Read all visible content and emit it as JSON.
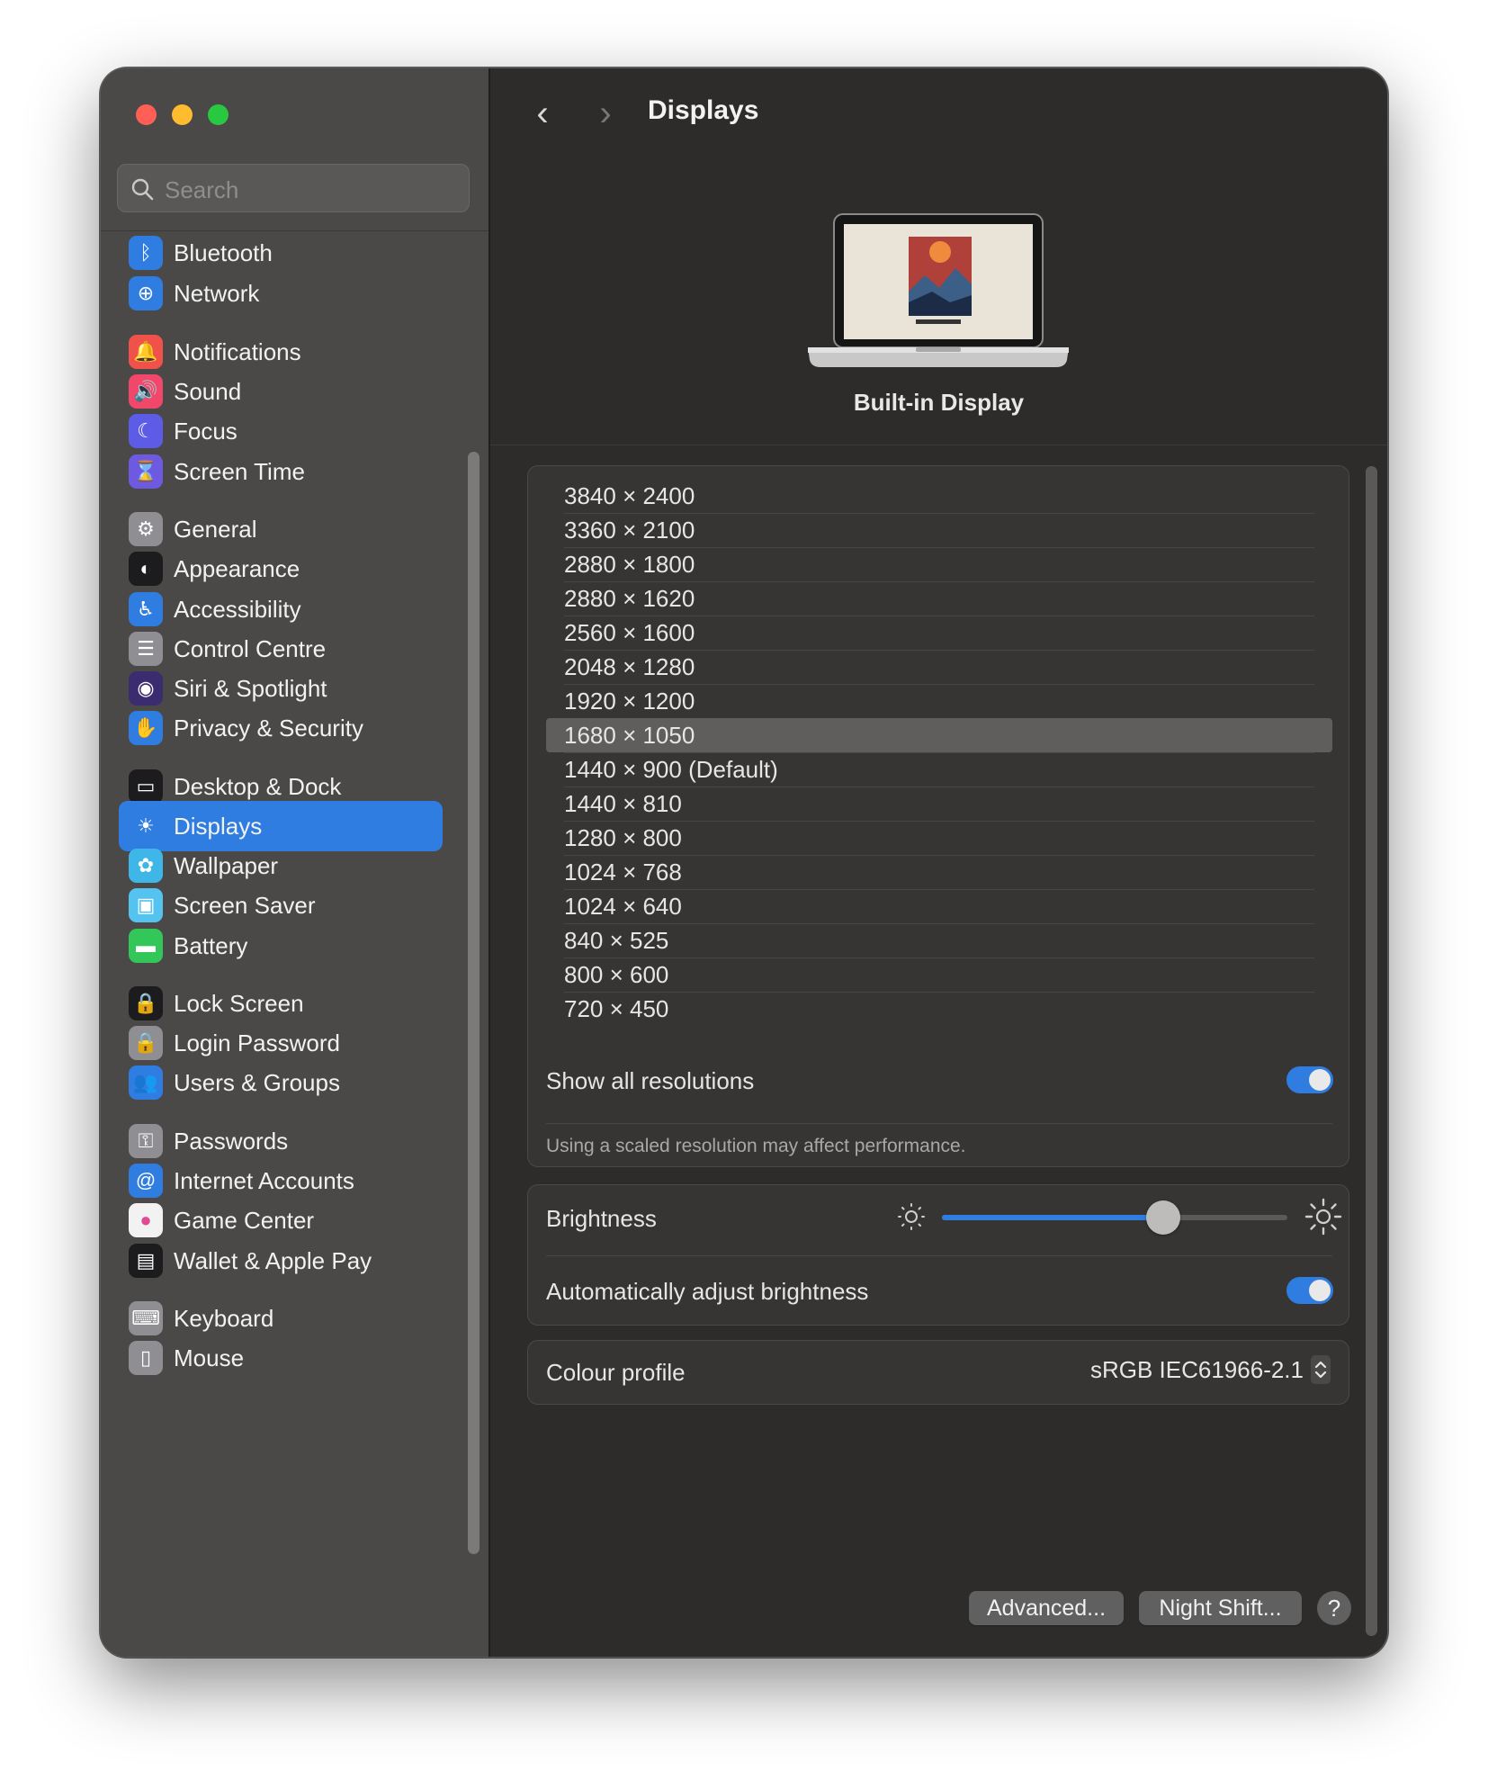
{
  "search": {
    "placeholder": "Search"
  },
  "sidebar": {
    "items": [
      {
        "label": "Bluetooth",
        "icon": "bluetooth-icon",
        "color": "#2f7de0"
      },
      {
        "label": "Network",
        "icon": "globe-icon",
        "color": "#2f7de0"
      },
      {
        "label": "Notifications",
        "icon": "bell-icon",
        "color": "#f0524b"
      },
      {
        "label": "Sound",
        "icon": "speaker-icon",
        "color": "#f0476b"
      },
      {
        "label": "Focus",
        "icon": "moon-icon",
        "color": "#5d5ce6"
      },
      {
        "label": "Screen Time",
        "icon": "hourglass-icon",
        "color": "#6e5ae0"
      },
      {
        "label": "General",
        "icon": "gear-icon",
        "color": "#8e8e93"
      },
      {
        "label": "Appearance",
        "icon": "appearance-icon",
        "color": "#1c1c1e"
      },
      {
        "label": "Accessibility",
        "icon": "accessibility-icon",
        "color": "#2f7de0"
      },
      {
        "label": "Control Centre",
        "icon": "switches-icon",
        "color": "#8e8e93"
      },
      {
        "label": "Siri & Spotlight",
        "icon": "siri-icon",
        "color": "#3a2c6e"
      },
      {
        "label": "Privacy & Security",
        "icon": "hand-icon",
        "color": "#2f7de0"
      },
      {
        "label": "Desktop & Dock",
        "icon": "dock-icon",
        "color": "#1c1c1e"
      },
      {
        "label": "Displays",
        "icon": "sun-icon",
        "color": "#2f7de0"
      },
      {
        "label": "Wallpaper",
        "icon": "flower-icon",
        "color": "#3fb6e8"
      },
      {
        "label": "Screen Saver",
        "icon": "screensaver-icon",
        "color": "#55c3f0"
      },
      {
        "label": "Battery",
        "icon": "battery-icon",
        "color": "#33c759"
      },
      {
        "label": "Lock Screen",
        "icon": "lock-icon",
        "color": "#1c1c1e"
      },
      {
        "label": "Login Password",
        "icon": "padlock-icon",
        "color": "#8e8e93"
      },
      {
        "label": "Users & Groups",
        "icon": "users-icon",
        "color": "#2f7de0"
      },
      {
        "label": "Passwords",
        "icon": "key-icon",
        "color": "#8e8e93"
      },
      {
        "label": "Internet Accounts",
        "icon": "at-icon",
        "color": "#2f7de0"
      },
      {
        "label": "Game Center",
        "icon": "game-center-icon",
        "color": "#f2f2f2"
      },
      {
        "label": "Wallet & Apple Pay",
        "icon": "wallet-icon",
        "color": "#1c1c1e"
      },
      {
        "label": "Keyboard",
        "icon": "keyboard-icon",
        "color": "#8e8e93"
      },
      {
        "label": "Mouse",
        "icon": "mouse-icon",
        "color": "#8e8e93"
      }
    ],
    "selected": "Displays"
  },
  "header": {
    "title": "Displays"
  },
  "display": {
    "name": "Built-in Display"
  },
  "resolutions": [
    "3840 × 2400",
    "3360 × 2100",
    "2880 × 1800",
    "2880 × 1620",
    "2560 × 1600",
    "2048 × 1280",
    "1920 × 1200",
    "1680 × 1050",
    "1440 × 900 (Default)",
    "1440 × 810",
    "1280 × 800",
    "1024 × 768",
    "1024 × 640",
    "840 × 525",
    "800 × 600",
    "720 × 450"
  ],
  "selected_resolution": "1680 × 1050",
  "show_all": {
    "label": "Show all resolutions",
    "enabled": true
  },
  "hint": "Using a scaled resolution may affect performance.",
  "brightness": {
    "label": "Brightness",
    "value": 0.64
  },
  "auto_brightness": {
    "label": "Automatically adjust brightness",
    "enabled": true
  },
  "colour_profile": {
    "label": "Colour profile",
    "value": "sRGB IEC61966-2.1"
  },
  "buttons": {
    "advanced": "Advanced...",
    "night_shift": "Night Shift...",
    "help": "?"
  },
  "colors": {
    "accent": "#2f7de0",
    "sidebar": "#4a4948",
    "main": "#2d2c2b"
  }
}
